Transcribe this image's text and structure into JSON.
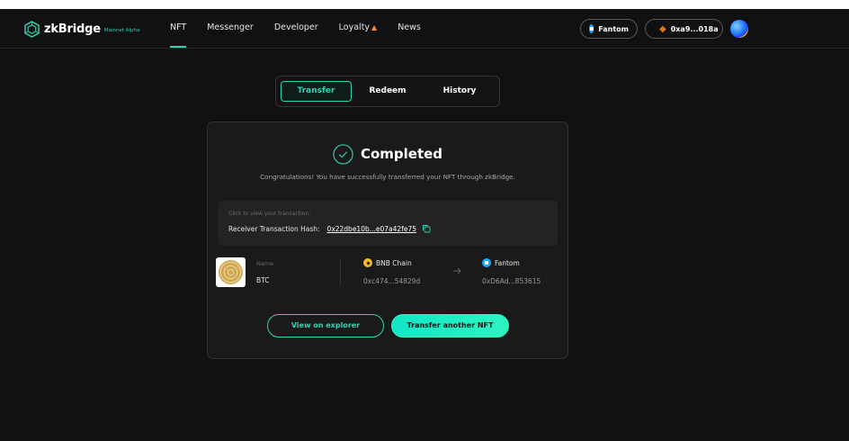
{
  "header": {
    "logo_text": "zkBridge",
    "logo_tag": "Mainnet Alpha",
    "nav": [
      {
        "label": "NFT",
        "active": true
      },
      {
        "label": "Messenger"
      },
      {
        "label": "Developer"
      },
      {
        "label": "Loyalty"
      },
      {
        "label": "News"
      }
    ],
    "network_label": "Fantom",
    "wallet_label": "0xa9...018a"
  },
  "tabs": [
    {
      "label": "Transfer",
      "active": true
    },
    {
      "label": "Redeem"
    },
    {
      "label": "History"
    }
  ],
  "result": {
    "title": "Completed",
    "message": "Congratulations! You have successfully transferred your NFT through zkBridge.",
    "tx_hint": "Click to view your transaction:",
    "tx_label": "Receiver Transaction Hash:",
    "tx_hash": "0x22dbe10b...e07a42fe75"
  },
  "nft": {
    "name_label": "Name",
    "name": "BTC",
    "source_chain": "BNB Chain",
    "source_address": "0xc474...54829d",
    "dest_chain": "Fantom",
    "dest_address": "0xD6Ad...853615"
  },
  "actions": {
    "explorer": "View on explorer",
    "transfer_again": "Transfer another NFT"
  },
  "colors": {
    "accent": "#2fd3b5",
    "background": "#111111",
    "card": "#1a1a1a"
  }
}
